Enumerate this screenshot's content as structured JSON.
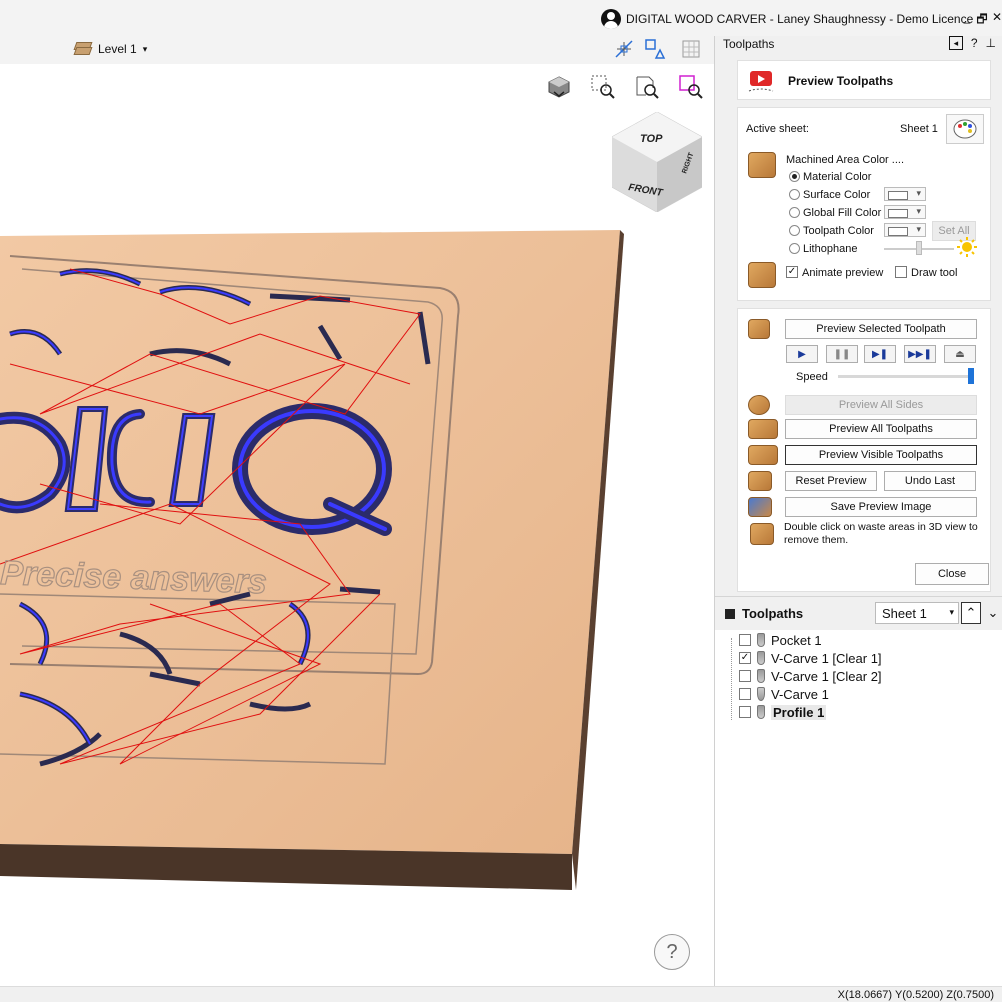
{
  "window": {
    "title": "DIGITAL WOOD CARVER - Laney Shaughnessy - Demo Licence",
    "minimize": "_",
    "restore": "🗗",
    "close": "✕"
  },
  "toolbar": {
    "level_label": "Level 1",
    "level_caret": "▾"
  },
  "dock": {
    "title": "Toolpaths",
    "help": "?",
    "pin": "⊥"
  },
  "preview": {
    "header_title": "Preview Toolpaths",
    "active_sheet_label": "Active sheet:",
    "active_sheet_value": "Sheet 1",
    "machined_area_label": "Machined Area Color ....",
    "options": {
      "material": "Material Color",
      "surface": "Surface Color",
      "global_fill": "Global Fill Color",
      "toolpath": "Toolpath Color",
      "lithophane": "Lithophane"
    },
    "selected_option": "material",
    "set_all": "Set All",
    "animate_preview": "Animate preview",
    "animate_checked": true,
    "draw_tool": "Draw tool",
    "draw_tool_checked": false,
    "preview_selected": "Preview Selected Toolpath",
    "speed_label": "Speed",
    "speed_value": 1.0,
    "preview_all_sides": "Preview All Sides",
    "preview_all_toolpaths": "Preview All Toolpaths",
    "preview_visible": "Preview Visible Toolpaths",
    "reset_preview": "Reset Preview",
    "undo_last": "Undo Last",
    "save_image": "Save Preview Image",
    "hint": "Double click on waste areas in 3D view to remove them.",
    "close": "Close"
  },
  "toolpaths_list": {
    "title": "Toolpaths",
    "sheet_select": "Sheet 1",
    "items": [
      {
        "name": "Pocket 1",
        "checked": false,
        "bold": false
      },
      {
        "name": "V-Carve 1 [Clear 1]",
        "checked": true,
        "bold": false
      },
      {
        "name": "V-Carve 1 [Clear 2]",
        "checked": false,
        "bold": false
      },
      {
        "name": "V-Carve 1",
        "checked": false,
        "bold": false
      },
      {
        "name": "Profile 1",
        "checked": false,
        "bold": true
      }
    ]
  },
  "viewcube": {
    "top": "TOP",
    "front": "FRONT",
    "right": "RIGHT"
  },
  "model_text": {
    "big_letters": "ldiQ",
    "tagline": "Precise answers"
  },
  "status": {
    "coords": "X(18.0667) Y(0.5200) Z(0.7500)"
  },
  "help_label": "?"
}
